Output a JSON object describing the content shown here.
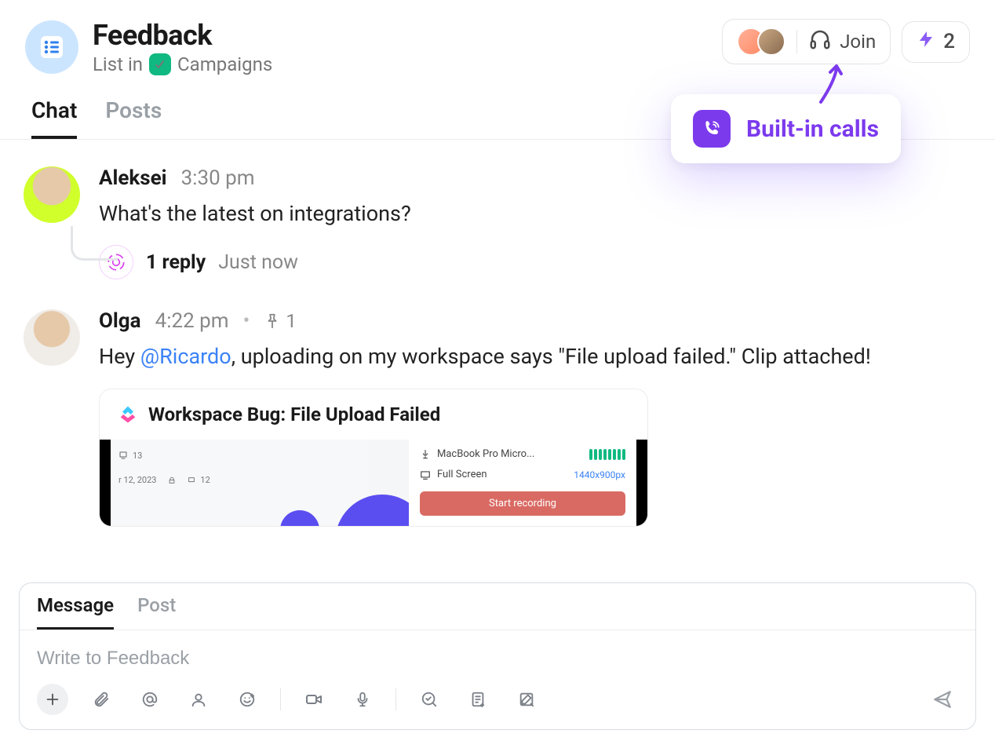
{
  "header": {
    "title": "Feedback",
    "subtitle_prefix": "List in",
    "folder_name": "Campaigns",
    "join_label": "Join",
    "activity_count": "2"
  },
  "tabs": {
    "chat": "Chat",
    "posts": "Posts"
  },
  "callout": {
    "label": "Built-in calls"
  },
  "messages": [
    {
      "author": "Aleksei",
      "time": "3:30 pm",
      "text": "What's the latest on integrations?",
      "reply_count": "1 reply",
      "reply_time": "Just now"
    },
    {
      "author": "Olga",
      "time": "4:22 pm",
      "pin_count": "1",
      "text_pre": "Hey ",
      "mention": "@Ricardo",
      "text_post": ", uploading on my workspace says \"File upload failed.\" Clip attached!",
      "attachment": {
        "title": "Workspace Bug: File Upload Failed",
        "mic_label": "MacBook Pro Micro...",
        "screen_label": "Full Screen",
        "resolution": "1440x900px",
        "record_button": "Start recording",
        "date_fragment": "r 12, 2023",
        "count_a": "13",
        "count_b": "12"
      }
    }
  ],
  "composer": {
    "tab_message": "Message",
    "tab_post": "Post",
    "placeholder": "Write to Feedback"
  }
}
